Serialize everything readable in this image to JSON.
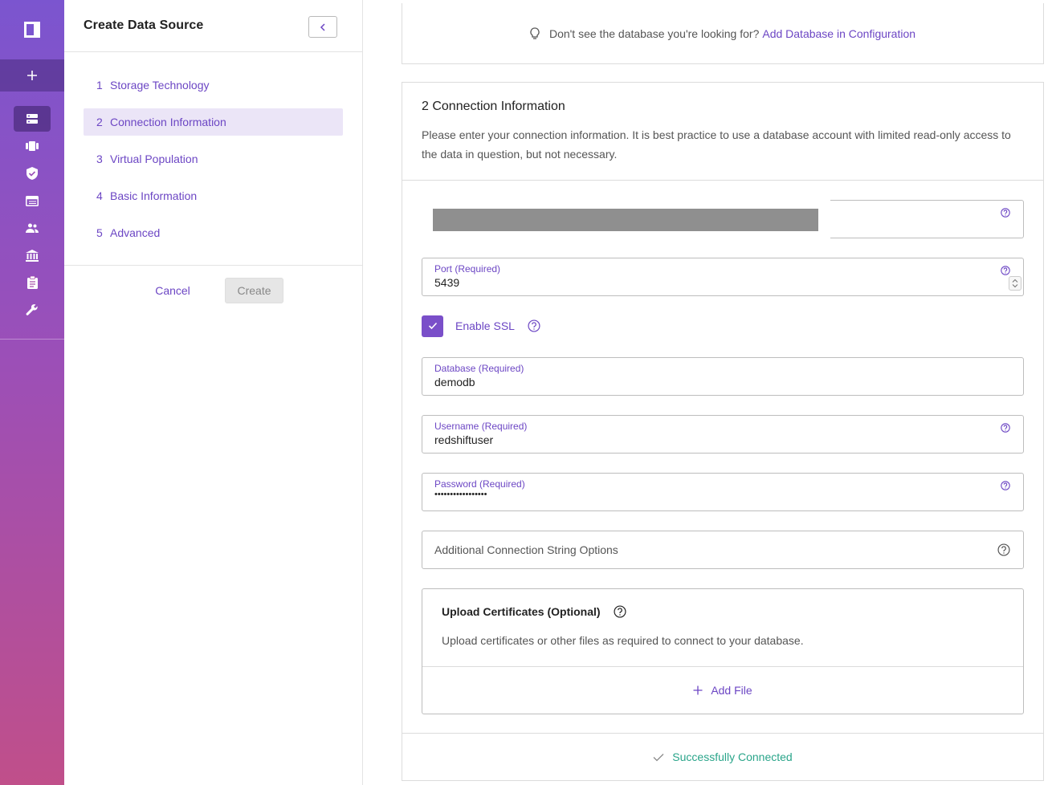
{
  "wizard": {
    "title": "Create Data Source",
    "steps": [
      {
        "num": "1",
        "label": "Storage Technology"
      },
      {
        "num": "2",
        "label": "Connection Information"
      },
      {
        "num": "3",
        "label": "Virtual Population"
      },
      {
        "num": "4",
        "label": "Basic Information"
      },
      {
        "num": "5",
        "label": "Advanced"
      }
    ],
    "active_step": 2,
    "cancel_label": "Cancel",
    "create_label": "Create"
  },
  "hint": {
    "text": "Don't see the database you're looking for?",
    "link": "Add Database in Configuration"
  },
  "connection": {
    "title": "2  Connection Information",
    "description": "Please enter your connection information. It is best practice to use a database account with limited read-only access to the data in question, but not necessary.",
    "port": {
      "label": "Port (Required)",
      "value": "5439"
    },
    "ssl": {
      "label": "Enable SSL",
      "checked": true
    },
    "database": {
      "label": "Database (Required)",
      "value": "demodb"
    },
    "username": {
      "label": "Username (Required)",
      "value": "redshiftuser"
    },
    "password": {
      "label": "Password (Required)",
      "value": "•••••••••••••••••"
    },
    "options_placeholder": "Additional Connection String Options",
    "upload": {
      "title": "Upload Certificates (Optional)",
      "description": "Upload certificates or other files as required to connect to your database.",
      "add_label": "Add File"
    },
    "status": "Successfully Connected"
  },
  "colors": {
    "accent": "#6c46c4",
    "success": "#2aa58a",
    "rail_top": "#7b55cf",
    "rail_bottom": "#c04f8a"
  },
  "icons": {
    "rail": [
      "logo-icon",
      "plus-icon",
      "data-sources-icon",
      "projects-icon",
      "policies-icon",
      "governance-icon",
      "people-icon",
      "audit-icon",
      "reports-icon",
      "settings-icon"
    ]
  }
}
